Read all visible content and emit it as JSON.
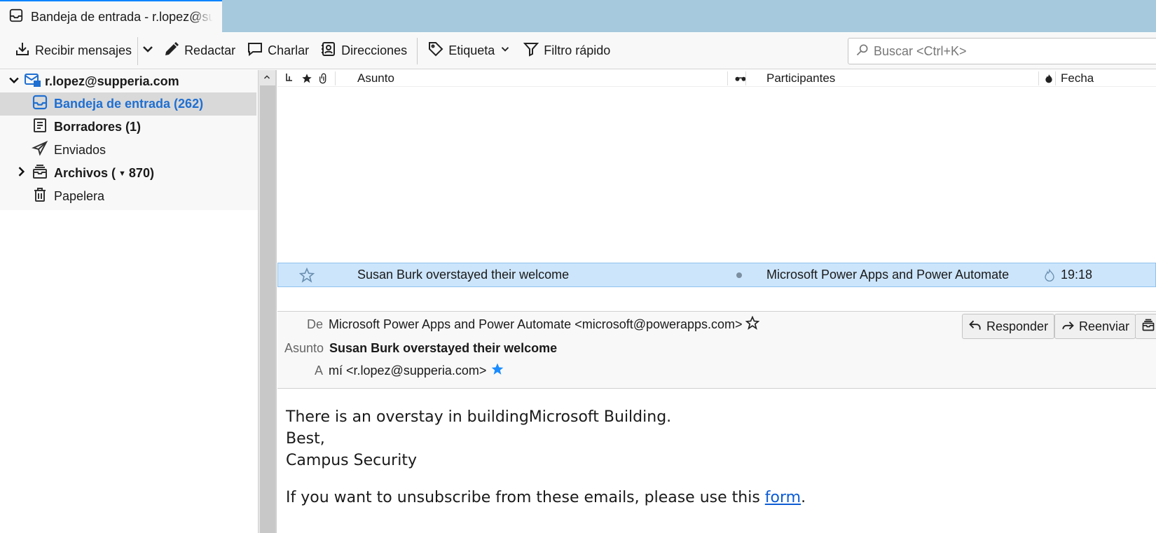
{
  "tab": {
    "title": "Bandeja de entrada - r.lopez@supperia.com"
  },
  "toolbar": {
    "get_messages": "Recibir mensajes",
    "compose": "Redactar",
    "chat": "Charlar",
    "address_book": "Direcciones",
    "tag": "Etiqueta",
    "quick_filter": "Filtro rápido",
    "search_placeholder": "Buscar <Ctrl+K>"
  },
  "folders": {
    "account": "r.lopez@supperia.com",
    "items": [
      {
        "label": "Bandeja de entrada (262)"
      },
      {
        "label": "Borradores (1)"
      },
      {
        "label": "Enviados"
      },
      {
        "label": "Archivos (",
        "count": "870)"
      },
      {
        "label": "Papelera"
      }
    ]
  },
  "columns": {
    "subject": "Asunto",
    "correspondents": "Participantes",
    "date": "Fecha"
  },
  "messages": [
    {
      "subject": "Susan Burk overstayed their welcome",
      "from": "Microsoft Power Apps and Power Automate",
      "date": "19:18"
    }
  ],
  "header": {
    "from_label": "De",
    "from_value": "Microsoft Power Apps and Power Automate <microsoft@powerapps.com>",
    "subject_label": "Asunto",
    "subject_value": "Susan Burk overstayed their welcome",
    "to_label": "A",
    "to_value": "mí <r.lopez@supperia.com>",
    "reply": "Responder",
    "forward": "Reenviar"
  },
  "body": {
    "line1": "There is an overstay in buildingMicrosoft Building.",
    "line2": "Best,",
    "line3": "Campus Security",
    "unsub_text": "If you want to unsubscribe from these emails, please use this ",
    "unsub_link": "form",
    "unsub_end": "."
  },
  "colors": {
    "accent": "#0a84ff",
    "selected_row": "#cce5fb",
    "link": "#0b5cd5",
    "tabbar": "#a7c9dd"
  }
}
